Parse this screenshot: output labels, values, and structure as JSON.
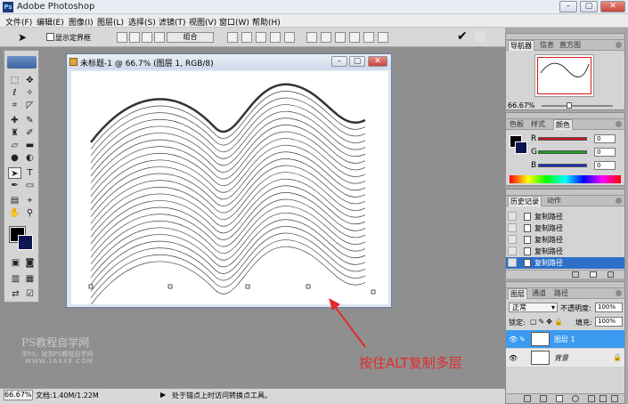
{
  "app": {
    "title": "Adobe Photoshop",
    "logo": "Ps"
  },
  "window_controls": {
    "minimize": "–",
    "maximize": "▢",
    "close": "✕"
  },
  "menu": [
    "文件(F)",
    "编辑(E)",
    "图像(I)",
    "图层(L)",
    "选择(S)",
    "滤镜(T)",
    "视图(V)",
    "窗口(W)",
    "帮助(H)"
  ],
  "options": {
    "show_bbox_label": "显示定界框",
    "combine_button": "组合"
  },
  "document": {
    "title": "未标题-1 @ 66.7% (图层 1, RGB/8)"
  },
  "navigator": {
    "tabs": [
      "导航器",
      "信息",
      "直方图"
    ],
    "zoom": "66.67%"
  },
  "color_panel": {
    "tabs": [
      "色板",
      "样式",
      "颜色"
    ],
    "channels": [
      {
        "label": "R",
        "value": "0",
        "color": "#c8161d"
      },
      {
        "label": "G",
        "value": "0",
        "color": "#1aa01a"
      },
      {
        "label": "B",
        "value": "0",
        "color": "#1a2fb8"
      }
    ]
  },
  "history_panel": {
    "tabs": [
      "历史记录",
      "动作"
    ],
    "items": [
      "复制路径",
      "复制路径",
      "复制路径",
      "复制路径",
      "复制路径",
      "复制路径"
    ]
  },
  "layers_panel": {
    "tabs": [
      "图层",
      "通道",
      "路径"
    ],
    "blend_mode": "正常",
    "opacity_label": "不透明度:",
    "opacity": "100%",
    "lock_label": "锁定:",
    "fill_label": "填充:",
    "fill": "100%",
    "layers": [
      {
        "name": "图层 1",
        "selected": true
      },
      {
        "name": "背景",
        "selected": false
      }
    ]
  },
  "status": {
    "zoom": "66.67%",
    "doc_info": "文档:1.40M/1.22M",
    "hint": "处于锚点上时访问转换点工具。"
  },
  "watermark": {
    "line1": "PS教程自学网",
    "line2": "学PS，就到PS教程自学网",
    "line3": "WWW.16XX8.COM"
  },
  "annotation": {
    "text": "按住ALT复制多层",
    "color": "#e32a2a"
  }
}
